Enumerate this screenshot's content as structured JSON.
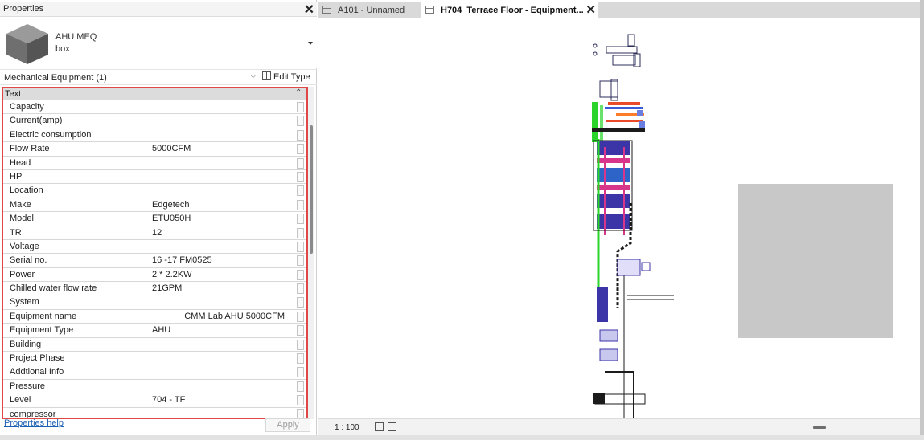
{
  "properties": {
    "title": "Properties",
    "type_name_line1": "AHU MEQ",
    "type_name_line2": "box",
    "filter_label": "Mechanical Equipment (1)",
    "edit_type_label": "Edit Type",
    "group_label": "Text",
    "rows": [
      {
        "name": "Capacity",
        "value": ""
      },
      {
        "name": "Current(amp)",
        "value": ""
      },
      {
        "name": "Electric consumption",
        "value": ""
      },
      {
        "name": "Flow Rate",
        "value": "5000CFM"
      },
      {
        "name": "Head",
        "value": ""
      },
      {
        "name": "HP",
        "value": ""
      },
      {
        "name": "Location",
        "value": ""
      },
      {
        "name": "Make",
        "value": "Edgetech"
      },
      {
        "name": "Model",
        "value": "ETU050H"
      },
      {
        "name": "TR",
        "value": "12"
      },
      {
        "name": "Voltage",
        "value": ""
      },
      {
        "name": "Serial no.",
        "value": "16 -17 FM0525"
      },
      {
        "name": "Power",
        "value": "2 * 2.2KW"
      },
      {
        "name": "Chilled water flow rate",
        "value": "21GPM"
      },
      {
        "name": "System",
        "value": ""
      },
      {
        "name": "Equipment name",
        "value": "CMM Lab AHU 5000CFM"
      },
      {
        "name": "Equipment Type",
        "value": "AHU"
      },
      {
        "name": "Building",
        "value": ""
      },
      {
        "name": "Project Phase",
        "value": ""
      },
      {
        "name": "Addtional Info",
        "value": ""
      },
      {
        "name": "Pressure",
        "value": ""
      },
      {
        "name": "Level",
        "value": "704 - TF"
      },
      {
        "name": "compressor",
        "value": ""
      }
    ],
    "help_link": "Properties help",
    "apply_label": "Apply"
  },
  "tabs": [
    {
      "label": "A101 - Unnamed",
      "active": false
    },
    {
      "label": "H704_Terrace Floor - Equipment...",
      "active": true
    }
  ],
  "view": {
    "scale": "1 : 100"
  },
  "colors": {
    "highlight_border": "#e04848",
    "link": "#1a5fb4",
    "group_bg": "#dcdcdc"
  }
}
